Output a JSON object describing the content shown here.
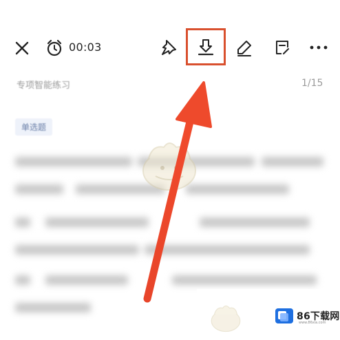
{
  "toolbar": {
    "close_icon": "close-icon",
    "alarm_icon": "alarm-clock-icon",
    "timer": "00:03",
    "pin_icon": "pin-icon",
    "download_icon": "download-icon",
    "edit_icon": "pen-icon",
    "note_icon": "note-icon",
    "more_icon": "more-icon"
  },
  "header": {
    "subtitle": "专项智能练习",
    "progress": "1/15"
  },
  "question": {
    "type_badge": "单选题"
  },
  "watermark": {
    "brand": "86下载网",
    "site": "www.86xia.com"
  },
  "colors": {
    "highlight": "#d9502e",
    "arrow": "#e8452a",
    "badge_bg": "#eef2fa",
    "badge_text": "#6a7fa8",
    "logo_blue": "#1e6fe0"
  }
}
